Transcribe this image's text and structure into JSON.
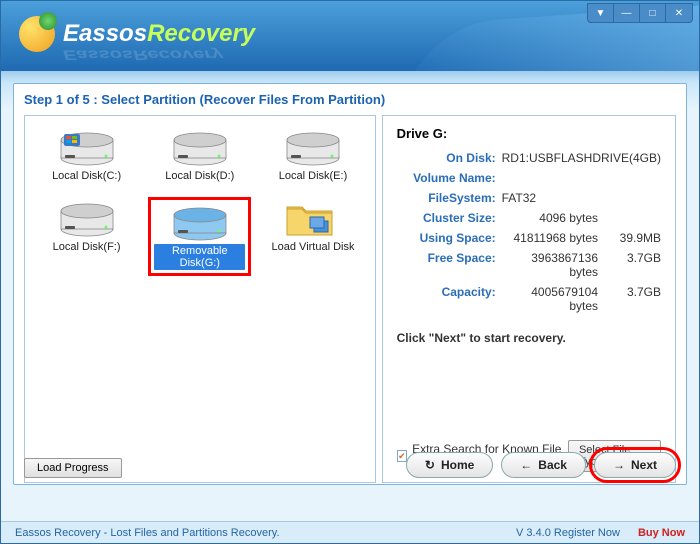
{
  "app": {
    "name_first": "Eassos",
    "name_second": "Recovery"
  },
  "step": {
    "title": "Step 1 of 5 : Select Partition (Recover Files From Partition)"
  },
  "disks": [
    {
      "label": "Local Disk(C:)",
      "type": "hdd-win"
    },
    {
      "label": "Local Disk(D:)",
      "type": "hdd"
    },
    {
      "label": "Local Disk(E:)",
      "type": "hdd"
    },
    {
      "label": "Local Disk(F:)",
      "type": "hdd"
    },
    {
      "label": "Removable Disk(G:)",
      "type": "removable",
      "selected": true,
      "highlight": true
    },
    {
      "label": "Load Virtual Disk",
      "type": "folder"
    }
  ],
  "details": {
    "title": "Drive G:",
    "on_disk_label": "On Disk:",
    "on_disk": "RD1:USBFLASHDRIVE(4GB)",
    "volume_name_label": "Volume Name:",
    "volume_name": "",
    "filesystem_label": "FileSystem:",
    "filesystem": "FAT32",
    "cluster_label": "Cluster Size:",
    "cluster": "4096 bytes",
    "using_label": "Using Space:",
    "using_bytes": "41811968 bytes",
    "using_h": "39.9MB",
    "free_label": "Free Space:",
    "free_bytes": "3963867136 bytes",
    "free_h": "3.7GB",
    "capacity_label": "Capacity:",
    "capacity_bytes": "4005679104 bytes",
    "capacity_h": "3.7GB",
    "hint": "Click \"Next\" to start recovery."
  },
  "opts": {
    "extra_search": "Extra Search for Known File Types",
    "extra_checked": true,
    "select_types": "Select File Types"
  },
  "buttons": {
    "load_progress": "Load Progress",
    "home": "Home",
    "back": "Back",
    "next": "Next"
  },
  "footer": {
    "tagline": "Eassos Recovery - Lost Files and Partitions Recovery.",
    "version": "V 3.4.0 Register Now",
    "buy": "Buy Now"
  }
}
